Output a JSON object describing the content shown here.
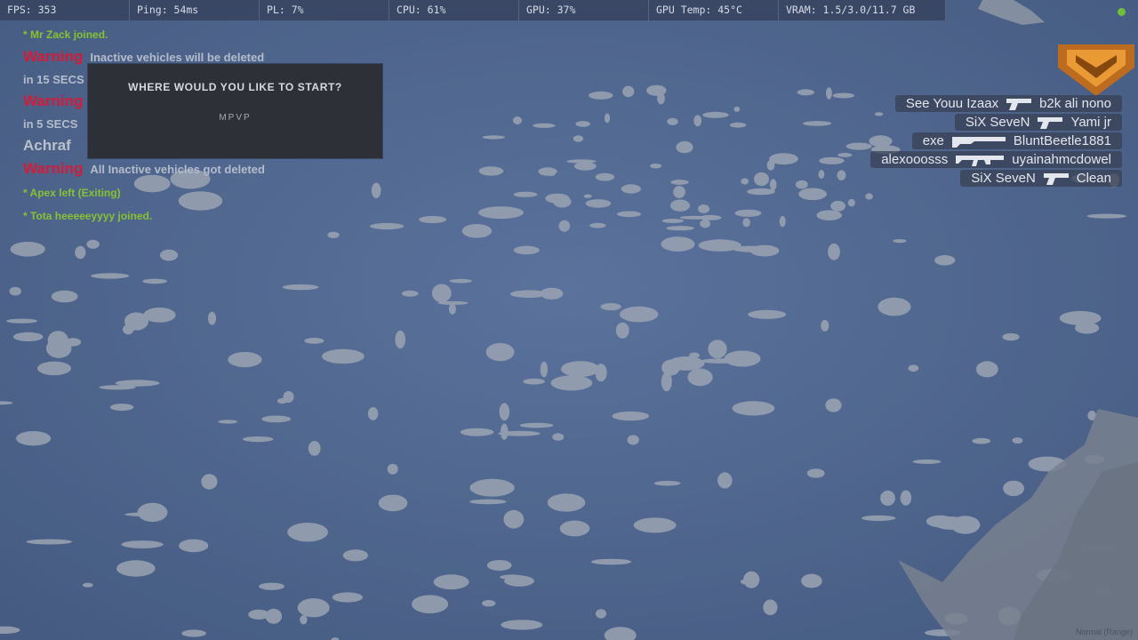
{
  "perf": {
    "fps": "FPS: 353",
    "ping": "Ping: 54ms",
    "pl": "PL: 7%",
    "cpu": "CPU: 61%",
    "gpu": "GPU: 37%",
    "gpu_temp": "GPU Temp: 45°C",
    "vram": "VRAM: 1.5/3.0/11.7 GB"
  },
  "chat": {
    "joined_1": "* Mr Zack joined.",
    "warning_1": "Warning",
    "warning_1_text": "Inactive vehicles will be deleted",
    "countdown_1": "in 15 SECS",
    "warning_2": "Warning",
    "countdown_2": "in 5 SECS",
    "player_name": "Achraf",
    "warning_3": "Warning",
    "warning_3_text": "All Inactive vehicles got deleted",
    "left_1": "* Apex left (Exiting)",
    "joined_2": "* Tota heeeeeyyyy joined."
  },
  "spawn_dialog": {
    "title": "WHERE WOULD YOU LIKE TO START?",
    "option": "MPVP"
  },
  "kill_feed": [
    {
      "killer": "See Youu Izaax",
      "weapon": "pistol-icon",
      "victim": "b2k ali nono"
    },
    {
      "killer": "SiX SeveN",
      "weapon": "pistol-icon",
      "victim": "Yami jr"
    },
    {
      "killer": "exe",
      "weapon": "shotgun-icon",
      "victim": "BluntBeetle1881"
    },
    {
      "killer": "alexooosss",
      "weapon": "smg-icon",
      "victim": "uyainahmcdowel"
    },
    {
      "killer": "SiX SeveN",
      "weapon": "pistol-icon",
      "victim": "Clean"
    }
  ],
  "footer": "Normal (Range)",
  "colors": {
    "chat_green": "#86c232",
    "warning_red": "#d51b3a",
    "ocean": "#5a74a0",
    "dialog_bg": "#2e3038",
    "logo_orange": "#e8881c"
  }
}
